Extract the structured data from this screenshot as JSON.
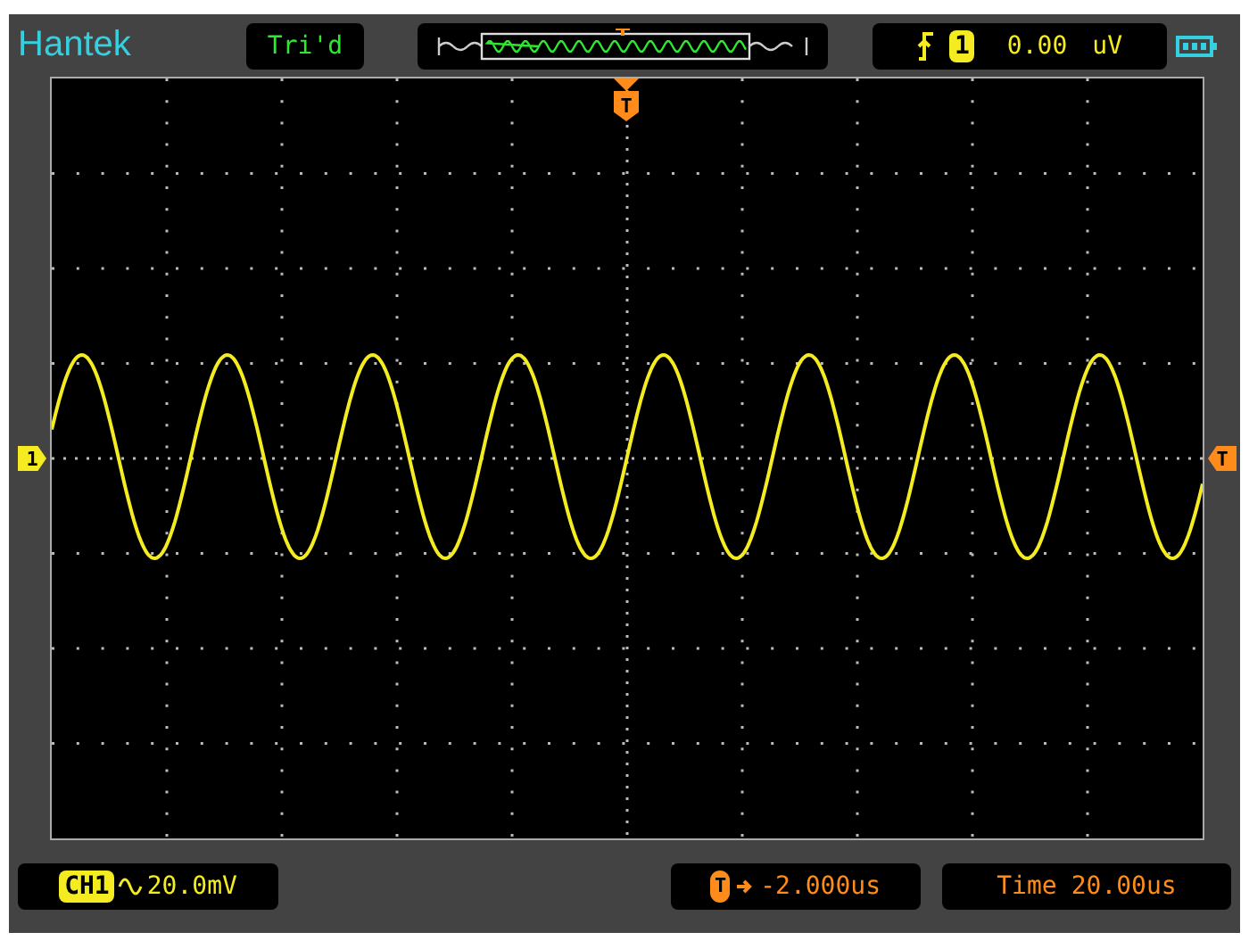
{
  "brand": "Hantek",
  "trigger_status": "Tri'd",
  "trigger_info": {
    "source": "1",
    "level": "0.00",
    "unit": "uV"
  },
  "screen": {
    "trigger_marker": "T",
    "channel_marker": "1",
    "level_marker": "T"
  },
  "channel": {
    "label": "CH1",
    "scale": "20.0mV"
  },
  "position": {
    "icon": "T",
    "value": "-2.000us"
  },
  "timebase": {
    "label": "Time",
    "value": "20.00us"
  }
}
